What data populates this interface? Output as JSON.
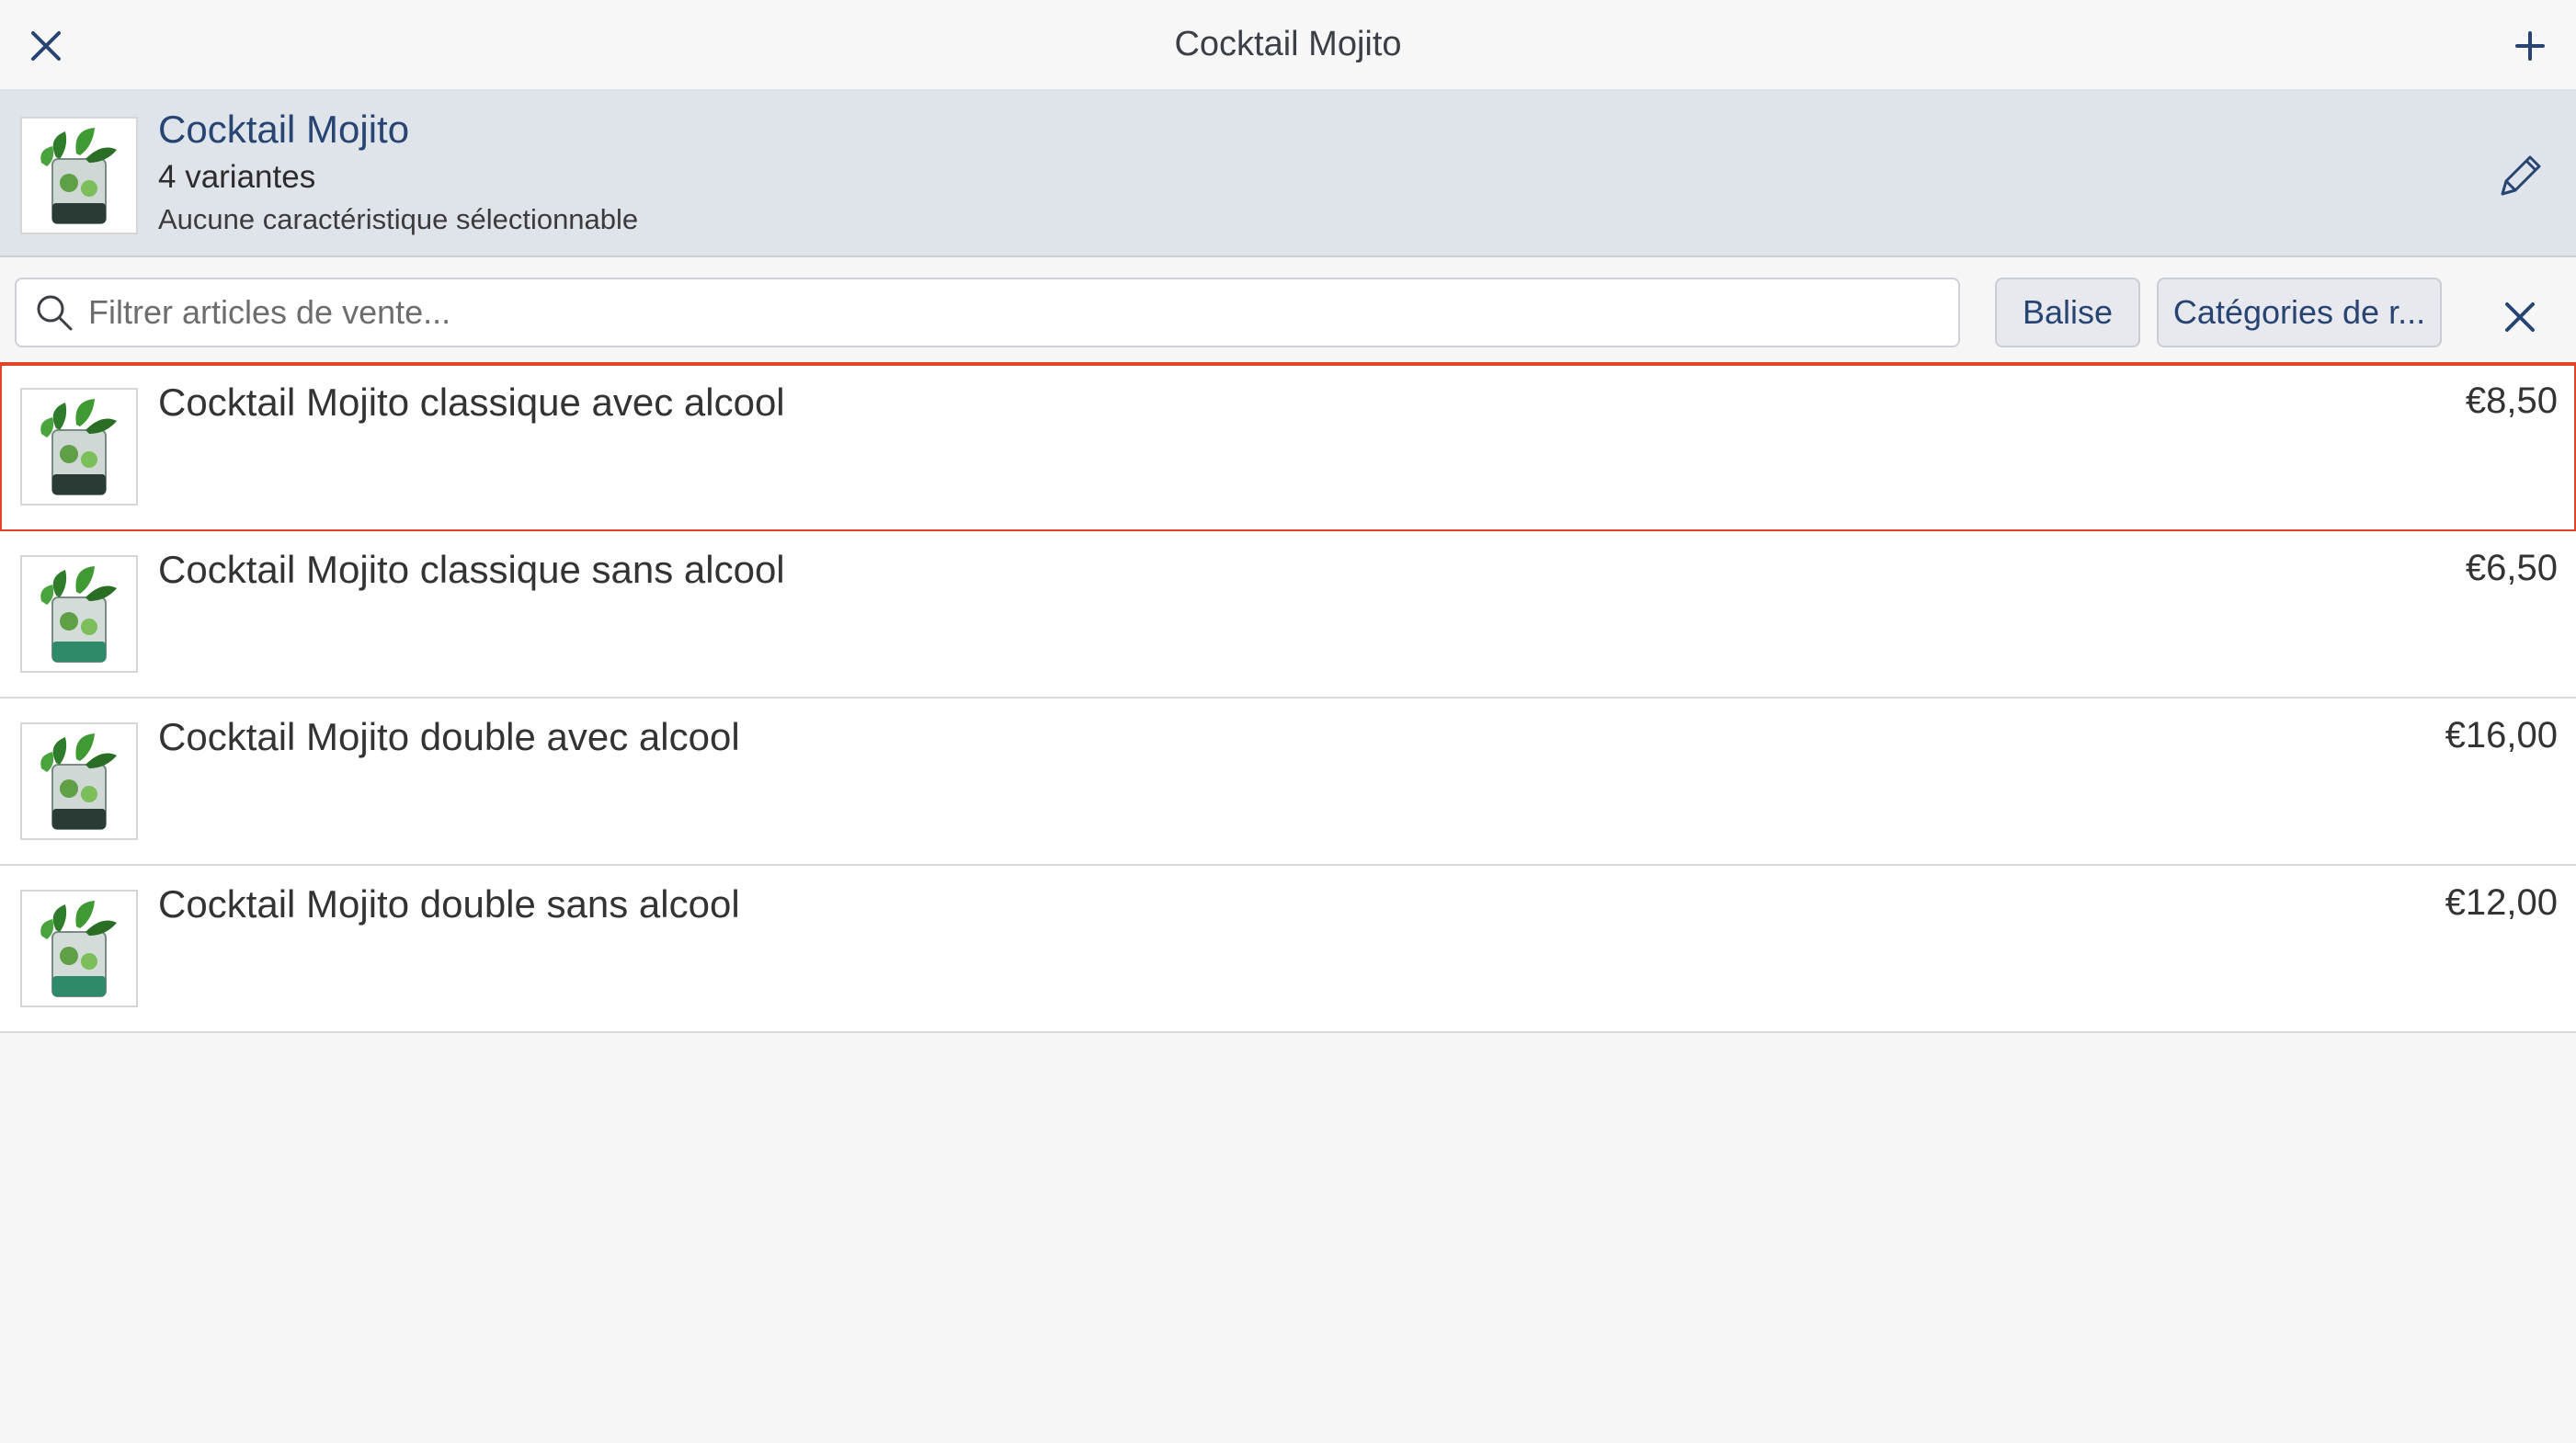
{
  "topbar": {
    "title": "Cocktail Mojito"
  },
  "product": {
    "title": "Cocktail Mojito",
    "variants": "4 variantes",
    "characteristics": "Aucune caractéristique sélectionnable"
  },
  "filter": {
    "placeholder": "Filtrer articles de vente...",
    "tag_label": "Balise",
    "category_label": "Catégories de r..."
  },
  "items": [
    {
      "name": "Cocktail Mojito classique avec alcool",
      "price": "€8,50",
      "selected": true
    },
    {
      "name": "Cocktail Mojito classique sans alcool",
      "price": "€6,50",
      "selected": false
    },
    {
      "name": "Cocktail Mojito double avec alcool",
      "price": "€16,00",
      "selected": false
    },
    {
      "name": "Cocktail Mojito double sans alcool",
      "price": "€12,00",
      "selected": false
    }
  ],
  "colors": {
    "accent": "#274472",
    "selection": "#e0452a",
    "header_bg": "#dfe3ea"
  }
}
